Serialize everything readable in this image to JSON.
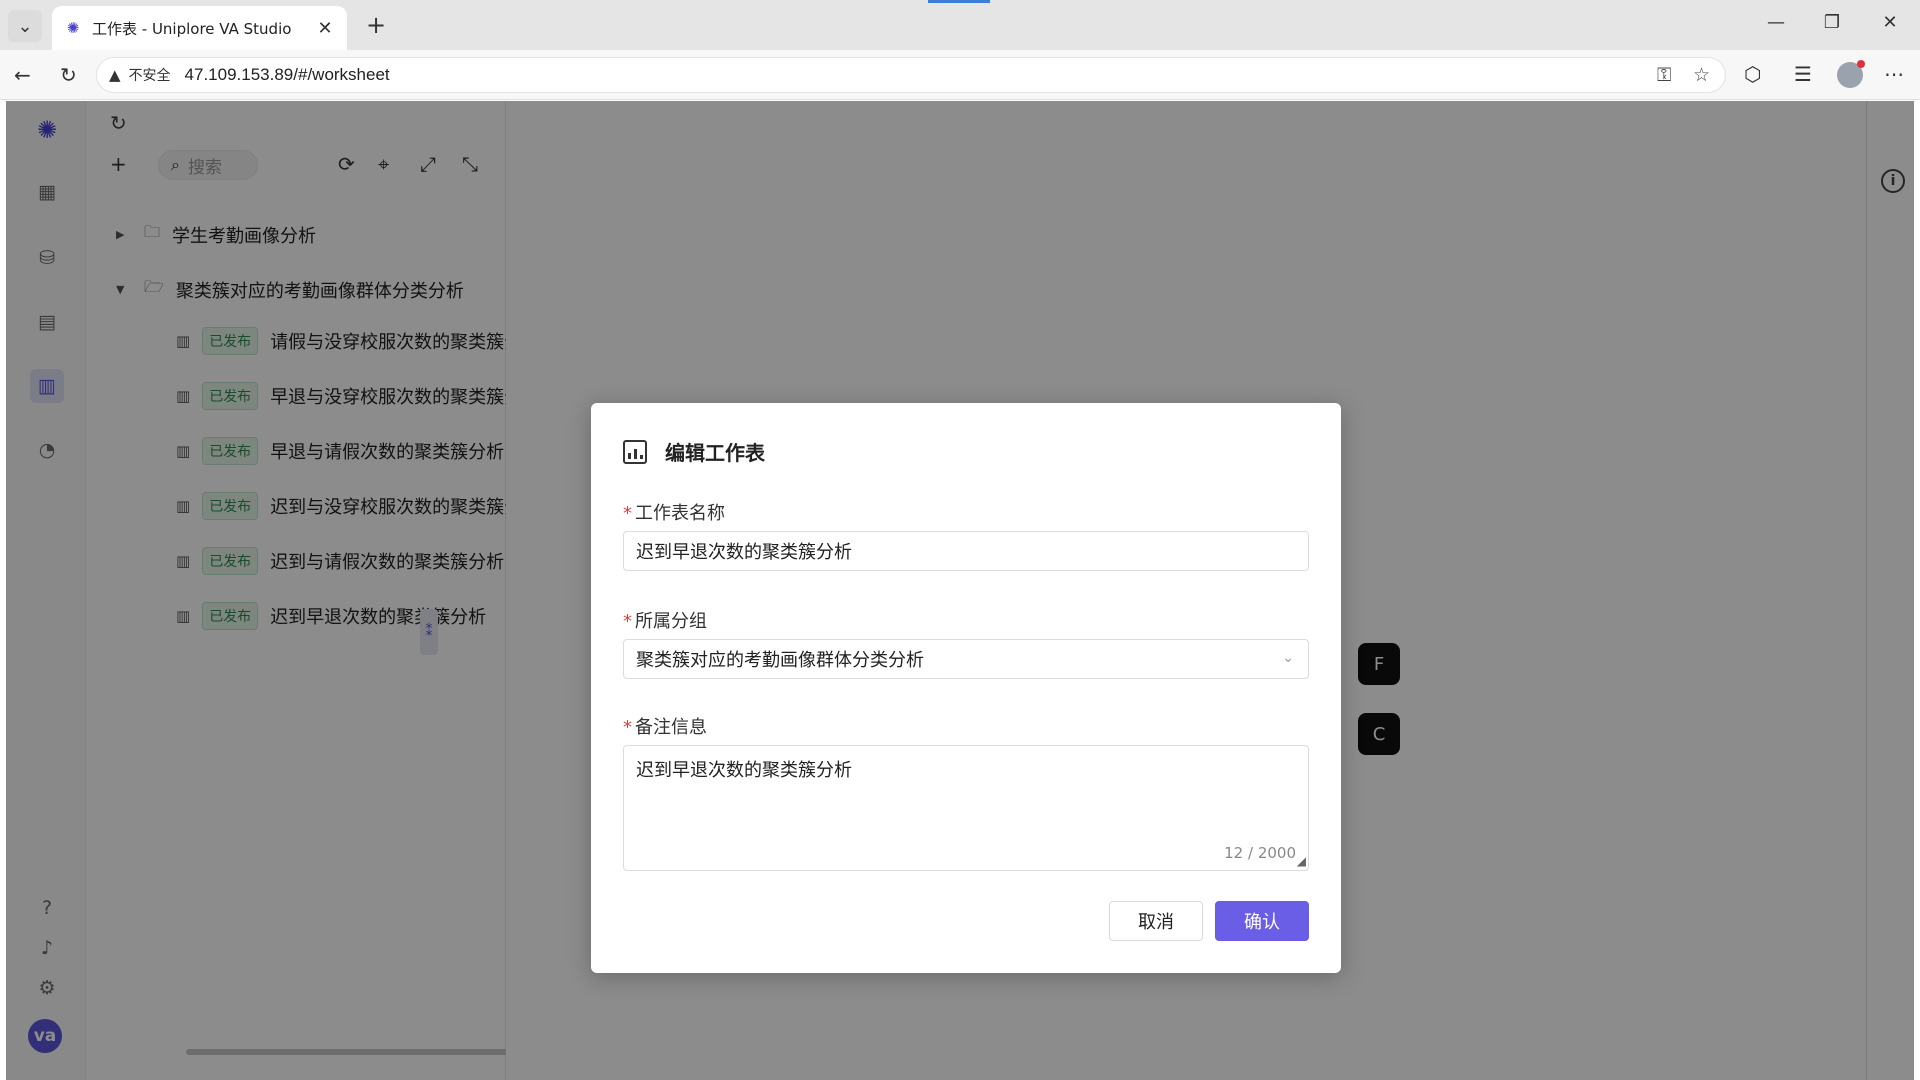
{
  "browser": {
    "tab_title": "工作表 - Uniplore VA Studio",
    "insecure_label": "不安全",
    "url": "47.109.153.89/#/worksheet"
  },
  "tree": {
    "search_placeholder": "搜索",
    "groups": [
      {
        "label": "学生考勤画像分析",
        "expanded": false
      },
      {
        "label": "聚类簇对应的考勤画像群体分类分析",
        "expanded": true
      }
    ],
    "sheets": [
      {
        "status": "已发布",
        "label": "请假与没穿校服次数的聚类簇分"
      },
      {
        "status": "已发布",
        "label": "早退与没穿校服次数的聚类簇分"
      },
      {
        "status": "已发布",
        "label": "早退与请假次数的聚类簇分析"
      },
      {
        "status": "已发布",
        "label": "迟到与没穿校服次数的聚类簇分"
      },
      {
        "status": "已发布",
        "label": "迟到与请假次数的聚类簇分析"
      },
      {
        "status": "已发布",
        "label": "迟到早退次数的聚类簇分析"
      }
    ]
  },
  "rail": {
    "avatar_text": "va"
  },
  "floating": {
    "f_label": "F",
    "c_label": "C"
  },
  "modal": {
    "title": "编辑工作表",
    "name_label": "工作表名称",
    "name_value": "迟到早退次数的聚类簇分析",
    "group_label": "所属分组",
    "group_value": "聚类簇对应的考勤画像群体分类分析",
    "remark_label": "备注信息",
    "remark_value": "迟到早退次数的聚类簇分析",
    "remark_count": "12 / 2000",
    "cancel_label": "取消",
    "confirm_label": "确认",
    "required_mark": "*"
  },
  "colors": {
    "accent": "#6a5de6",
    "published_green": "#2e8b4e"
  }
}
